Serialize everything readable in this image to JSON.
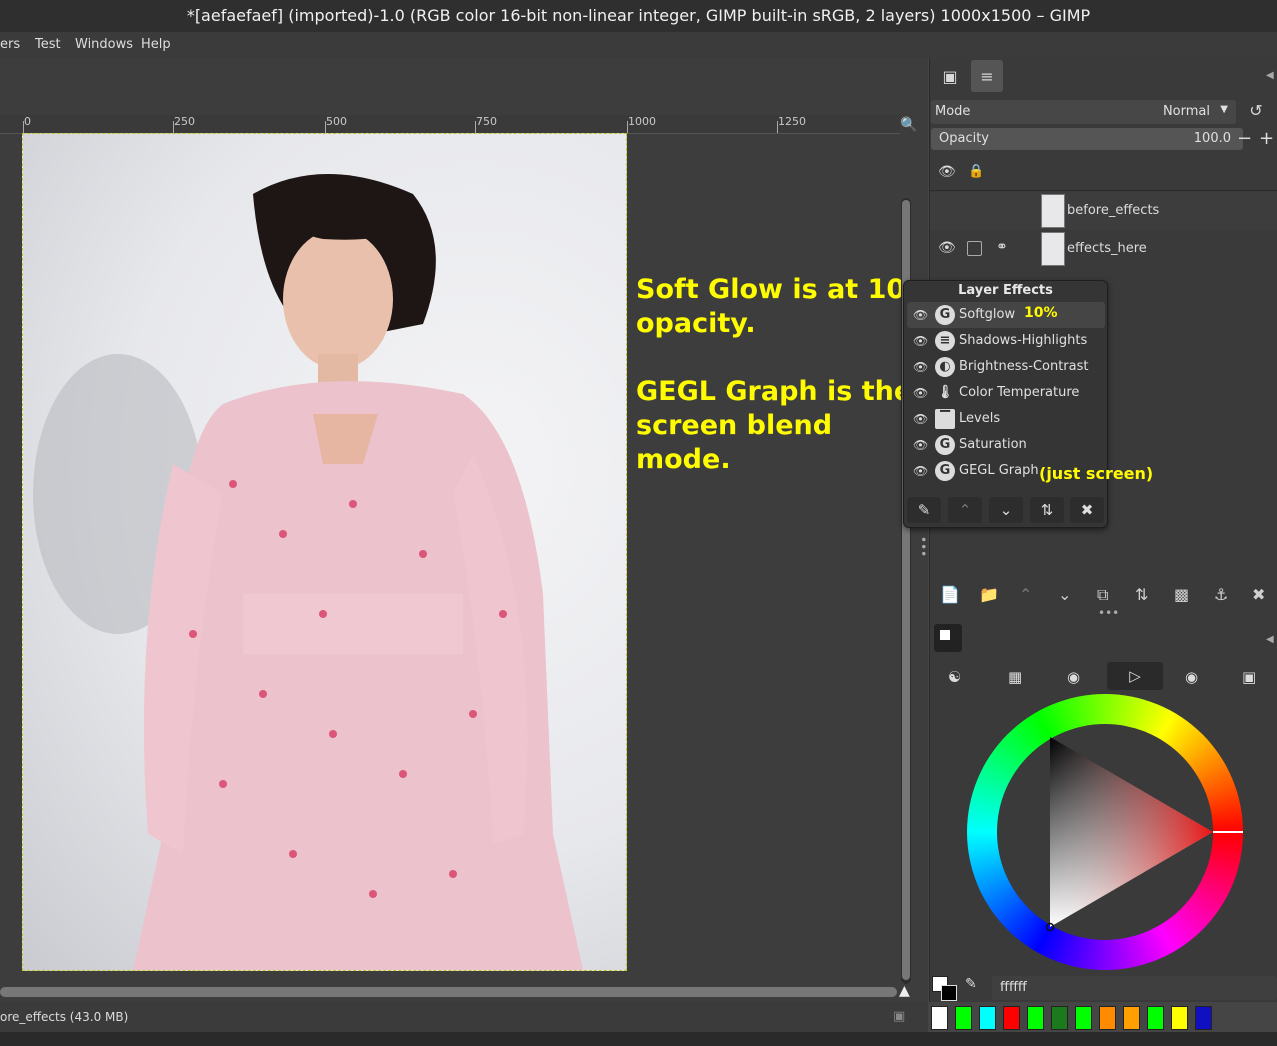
{
  "window": {
    "title": "*[aefaefaef] (imported)-1.0 (RGB color 16-bit non-linear integer, GIMP built-in sRGB, 2 layers) 1000x1500 – GIMP"
  },
  "menubar": {
    "items": [
      "ers",
      "Test",
      "Windows",
      "Help"
    ]
  },
  "ruler": {
    "labels": [
      "0",
      "250",
      "500",
      "750",
      "1000",
      "1250"
    ]
  },
  "annotation": {
    "line1": "Soft Glow is at 10 opacity.",
    "line2": "GEGL Graph is the screen blend mode."
  },
  "layers_panel": {
    "mode_label": "Mode",
    "mode_value": "Normal",
    "opacity_label": "Opacity",
    "opacity_value": "100.0",
    "layers": [
      {
        "name": "before_effects"
      },
      {
        "name": "effects_here"
      }
    ]
  },
  "effects_popup": {
    "title": "Layer Effects",
    "items": [
      {
        "label": "Softglow",
        "icon": "gegl-icon",
        "note": "10%"
      },
      {
        "label": "Shadows-Highlights",
        "icon": "shadows-highlights-icon"
      },
      {
        "label": "Brightness-Contrast",
        "icon": "brightness-contrast-icon"
      },
      {
        "label": "Color Temperature",
        "icon": "color-temperature-icon"
      },
      {
        "label": "Levels",
        "icon": "levels-icon"
      },
      {
        "label": "Saturation",
        "icon": "gegl-icon"
      },
      {
        "label": "GEGL Graph",
        "icon": "gegl-icon",
        "note": "(just screen)"
      }
    ]
  },
  "colors_panel": {
    "hex_value": "ffffff",
    "swatches": [
      "#ffffff",
      "#00ff00",
      "#00ffff",
      "#ff0000",
      "#00ff00",
      "#1c7a1c",
      "#00ff00",
      "#ff8c00",
      "#ff9f00",
      "#00ff00",
      "#ffff00",
      "#1010c0"
    ]
  },
  "statusbar": {
    "text": "ore_effects (43.0 MB)"
  }
}
